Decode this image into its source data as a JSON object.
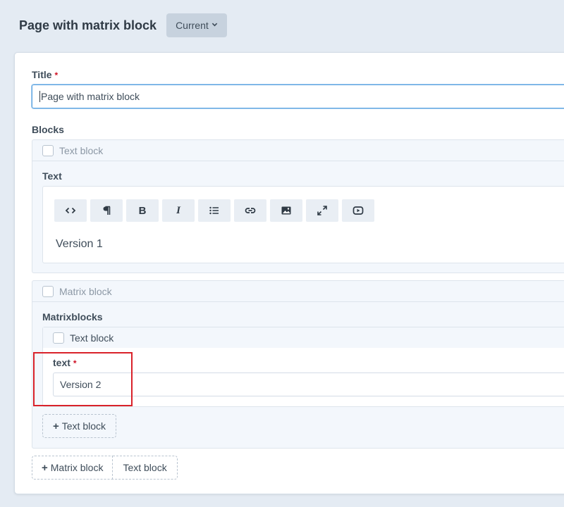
{
  "header": {
    "title": "Page with matrix block",
    "revision_label": "Current"
  },
  "form": {
    "title_label": "Title",
    "required_mark": "*",
    "title_value": "Page with matrix block",
    "blocks_label": "Blocks"
  },
  "text_block": {
    "type_label": "Text block",
    "field_label": "Text",
    "toolbar": [
      "code",
      "paragraph",
      "bold",
      "italic",
      "bullet-list",
      "link",
      "image",
      "fullscreen",
      "video"
    ],
    "toolbar_labels": {
      "bold": "B",
      "italic": "I"
    },
    "content": "Version 1"
  },
  "matrix_block": {
    "type_label": "Matrix block",
    "field_label": "Matrixblocks",
    "inner_block": {
      "type_label": "Text block",
      "field_label": "text",
      "value": "Version 2"
    },
    "add_inner_label": "Text block"
  },
  "add_buttons": {
    "matrix_label": "Matrix block",
    "text_label": "Text block"
  },
  "colors": {
    "background": "#e4ebf3",
    "required": "#cf1124",
    "focus": "#5aa3e0",
    "highlight": "#d9222a"
  }
}
